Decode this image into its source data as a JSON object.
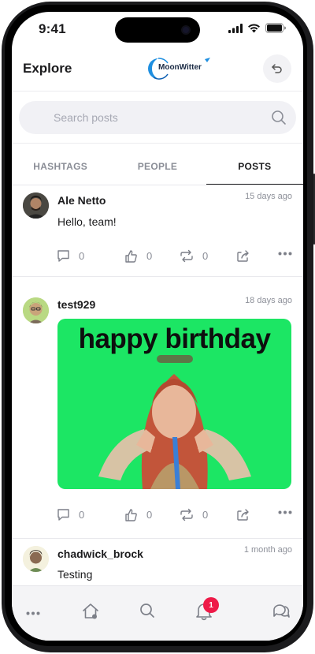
{
  "status_bar": {
    "time": "9:41"
  },
  "header": {
    "title": "Explore",
    "logo_text": "MoonWitter"
  },
  "search": {
    "placeholder": "Search posts",
    "value": ""
  },
  "tabs": [
    {
      "label": "HASHTAGS",
      "active": false
    },
    {
      "label": "PEOPLE",
      "active": false
    },
    {
      "label": "POSTS",
      "active": true
    }
  ],
  "posts": [
    {
      "author": "Ale Netto",
      "time": "15 days ago",
      "text": "Hello, team!",
      "comments": "0",
      "likes": "0",
      "reposts": "0"
    },
    {
      "author": "test929",
      "time": "18 days ago",
      "text": "",
      "gif_caption": "happy birthday",
      "comments": "0",
      "likes": "0",
      "reposts": "0"
    },
    {
      "author": "chadwick_brock",
      "time": "1 month ago",
      "text": "Testing"
    }
  ],
  "bottom_nav": {
    "items": [
      "more-icon",
      "home-icon",
      "search-icon",
      "notifications-icon",
      "messages-icon"
    ],
    "notification_count": "1"
  },
  "colors": {
    "accent": "#1f8fe0",
    "badge": "#ee1a48",
    "gif_background": "#1ce664"
  }
}
